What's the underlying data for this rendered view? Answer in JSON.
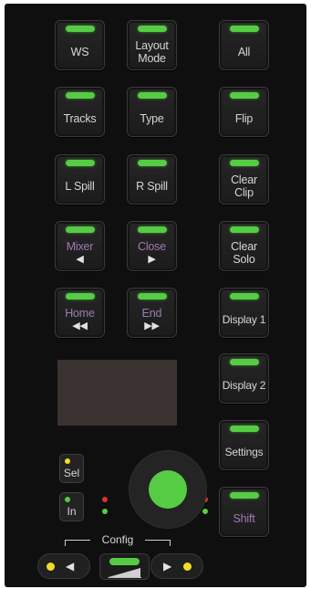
{
  "buttons": {
    "ws": "WS",
    "layout_mode": [
      "Layout",
      "Mode"
    ],
    "all": "All",
    "tracks": "Tracks",
    "type": "Type",
    "flip": "Flip",
    "l_spill": "L Spill",
    "r_spill": "R Spill",
    "clear_clip": [
      "Clear",
      "Clip"
    ],
    "mixer": "Mixer",
    "close": "Close",
    "clear_solo": [
      "Clear",
      "Solo"
    ],
    "home": "Home",
    "end": "End",
    "display1": "Display 1",
    "display2": "Display 2",
    "settings": "Settings",
    "shift": "Shift"
  },
  "glyphs": {
    "left": "◀",
    "right": "▶",
    "rewind": "◀◀",
    "forward": "▶▶"
  },
  "mini_buttons": {
    "sel": "Sel",
    "in": "In"
  },
  "config": {
    "label": "Config"
  },
  "colors": {
    "led_green": "#55cc44",
    "led_yellow": "#f2dc27",
    "led_red": "#e03030",
    "secondary_label": "#a07ab5",
    "panel": "#0f0f0f",
    "display_screen": "#3a3331"
  }
}
